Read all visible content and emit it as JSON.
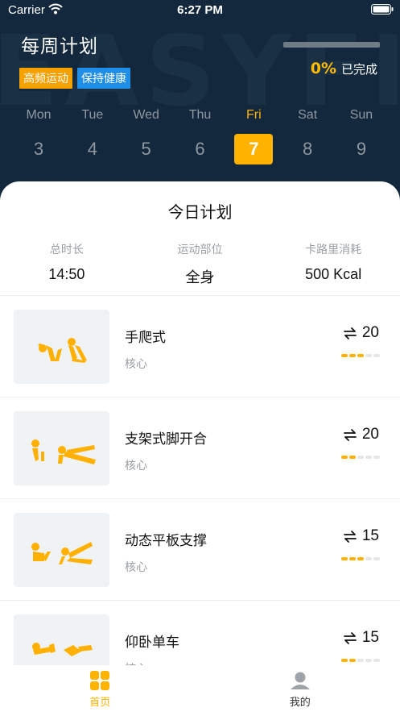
{
  "status_bar": {
    "carrier": "Carrier",
    "time": "6:27 PM"
  },
  "header": {
    "watermark": "EASYFIT",
    "title": "每周计划",
    "tags": [
      "高频运动",
      "保持健康"
    ],
    "progress": {
      "percent_text": "0%",
      "label": "已完成",
      "fraction": 0
    }
  },
  "week": {
    "days": [
      {
        "name": "Mon",
        "num": "3"
      },
      {
        "name": "Tue",
        "num": "4"
      },
      {
        "name": "Wed",
        "num": "5"
      },
      {
        "name": "Thu",
        "num": "6"
      },
      {
        "name": "Fri",
        "num": "7"
      },
      {
        "name": "Sat",
        "num": "8"
      },
      {
        "name": "Sun",
        "num": "9"
      }
    ],
    "selected": "Fri"
  },
  "today": {
    "title": "今日计划",
    "stats": [
      {
        "label": "总时长",
        "value": "14:50"
      },
      {
        "label": "运动部位",
        "value": "全身"
      },
      {
        "label": "卡路里消耗",
        "value": "500 Kcal"
      }
    ],
    "exercises": [
      {
        "name": "手爬式",
        "category": "核心",
        "reps": "20",
        "difficulty": 3,
        "icon": "inchworm-figure"
      },
      {
        "name": "支架式脚开合",
        "category": "核心",
        "reps": "20",
        "difficulty": 2,
        "icon": "plank-jack-figure"
      },
      {
        "name": "动态平板支撑",
        "category": "核心",
        "reps": "15",
        "difficulty": 3,
        "icon": "dynamic-plank-figure"
      },
      {
        "name": "仰卧单车",
        "category": "核心",
        "reps": "15",
        "difficulty": 2,
        "icon": "bicycle-crunch-figure"
      }
    ]
  },
  "tabbar": {
    "items": [
      {
        "label": "首页",
        "icon": "grid-icon",
        "active": true
      },
      {
        "label": "我的",
        "icon": "user-icon",
        "active": false
      }
    ]
  },
  "colors": {
    "accent": "#ffb300",
    "header_bg": "#13283c",
    "tag_orange": "#f5a100",
    "tag_blue": "#1f8ee6"
  }
}
